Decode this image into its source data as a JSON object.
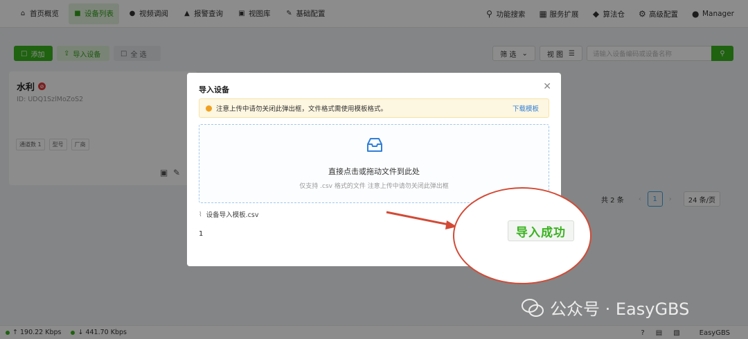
{
  "nav": {
    "left": [
      {
        "label": "首页概览",
        "icon": "home-icon",
        "active": false
      },
      {
        "label": "设备列表",
        "icon": "camera-icon",
        "active": true
      },
      {
        "label": "视频调阅",
        "icon": "play-icon",
        "active": false
      },
      {
        "label": "报警查询",
        "icon": "alarm-icon",
        "active": false
      },
      {
        "label": "视图库",
        "icon": "image-icon",
        "active": false
      },
      {
        "label": "基础配置",
        "icon": "edit-icon",
        "active": false
      }
    ],
    "right": [
      {
        "label": "功能搜索",
        "icon": "search-icon"
      },
      {
        "label": "服务扩展",
        "icon": "grid-icon"
      },
      {
        "label": "算法仓",
        "icon": "dropbox-icon"
      },
      {
        "label": "高级配置",
        "icon": "gear-icon"
      },
      {
        "label": "Manager",
        "icon": "user-icon"
      }
    ]
  },
  "toolbar": {
    "add_label": "添加",
    "import_label": "导入设备",
    "select_all_label": "全 选",
    "filter_label": "筛 选",
    "view_label": "视 图",
    "search_placeholder": "请输入设备编码或设备名称"
  },
  "card": {
    "name": "水利",
    "id": "ID: UDQ1SzlMoZoS2",
    "tags": [
      "通道数 1",
      "型号",
      "厂商"
    ]
  },
  "pager": {
    "total": "共 2 条",
    "page": "1",
    "size": "24 条/页"
  },
  "footer": {
    "upload": "↑ 190.22 Kbps",
    "download": "↓ 441.70 Kbps",
    "brand": "EasyGBS"
  },
  "modal": {
    "title": "导入设备",
    "alert": "注意上传中请勿关闭此弹出框，文件格式需使用模板格式。",
    "download_link": "下载模板",
    "drop_main": "直接点击或拖动文件到此处",
    "drop_hint": "仅支持 .csv 格式的文件 注意上传中请勿关闭此弹出框",
    "file_name": "设备导入模板.csv",
    "count": "1"
  },
  "annotation": {
    "label": "导入成功"
  },
  "watermark": "公众号 · EasyGBS",
  "colors": {
    "accent": "#3ab31e",
    "link": "#2f7fd8",
    "annotation": "#d24a36"
  }
}
